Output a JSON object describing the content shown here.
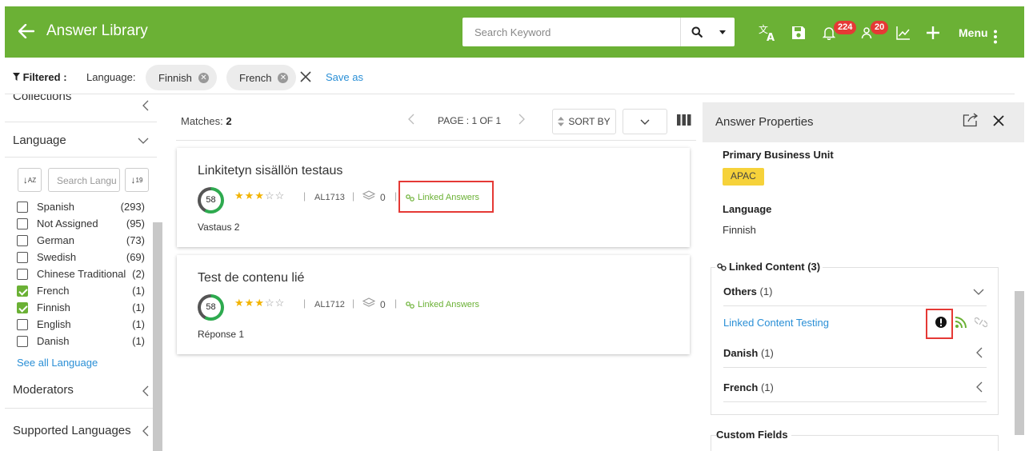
{
  "header": {
    "title": "Answer Library",
    "search_placeholder": "Search Keyword",
    "notifications_count": "224",
    "users_count": "20",
    "menu_label": "Menu"
  },
  "filterbar": {
    "filtered_label": "Filtered :",
    "language_label": "Language:",
    "chips": [
      "Finnish",
      "French"
    ],
    "save_as": "Save as"
  },
  "sidebar": {
    "collections": "Collections",
    "language": "Language",
    "search_placeholder": "Search Langu",
    "languages": [
      {
        "name": "Spanish",
        "count": "(293)",
        "checked": false
      },
      {
        "name": "Not Assigned",
        "count": "(95)",
        "checked": false
      },
      {
        "name": "German",
        "count": "(73)",
        "checked": false
      },
      {
        "name": "Swedish",
        "count": "(69)",
        "checked": false
      },
      {
        "name": "Chinese Traditional",
        "count": "(2)",
        "checked": false
      },
      {
        "name": "French",
        "count": "(1)",
        "checked": true
      },
      {
        "name": "Finnish",
        "count": "(1)",
        "checked": true
      },
      {
        "name": "English",
        "count": "(1)",
        "checked": false
      },
      {
        "name": "Danish",
        "count": "(1)",
        "checked": false
      }
    ],
    "see_all": "See all Language",
    "moderators": "Moderators",
    "supported_languages": "Supported Languages"
  },
  "main": {
    "matches_label": "Matches:",
    "matches_count": "2",
    "page_label": "PAGE : 1 OF 1",
    "sort_by": "SORT BY",
    "cards": [
      {
        "title": "Linkitetyn sisällön testaus",
        "score": "58",
        "rating": 3,
        "id": "AL1713",
        "layers": "0",
        "linked": "Linked Answers",
        "answer": "Vastaus 2"
      },
      {
        "title": "Test de contenu lié",
        "score": "58",
        "rating": 3,
        "id": "AL1712",
        "layers": "0",
        "linked": "Linked Answers",
        "answer": "Réponse 1"
      }
    ]
  },
  "panel": {
    "title": "Answer Properties",
    "primary_bu_label": "Primary Business Unit",
    "primary_bu_value": "APAC",
    "language_label": "Language",
    "language_value": "Finnish",
    "linked_content_label": "Linked Content (3)",
    "groups": [
      {
        "name": "Others",
        "count": "(1)"
      },
      {
        "name": "Danish",
        "count": "(1)"
      },
      {
        "name": "French",
        "count": "(1)"
      }
    ],
    "linked_item": "Linked Content Testing",
    "custom_fields_label": "Custom Fields"
  },
  "colors": {
    "brand": "#6bb135",
    "badge": "#e53935",
    "link": "#2a8fd6",
    "tag": "#f6d23a",
    "highlight": "#e53935"
  }
}
